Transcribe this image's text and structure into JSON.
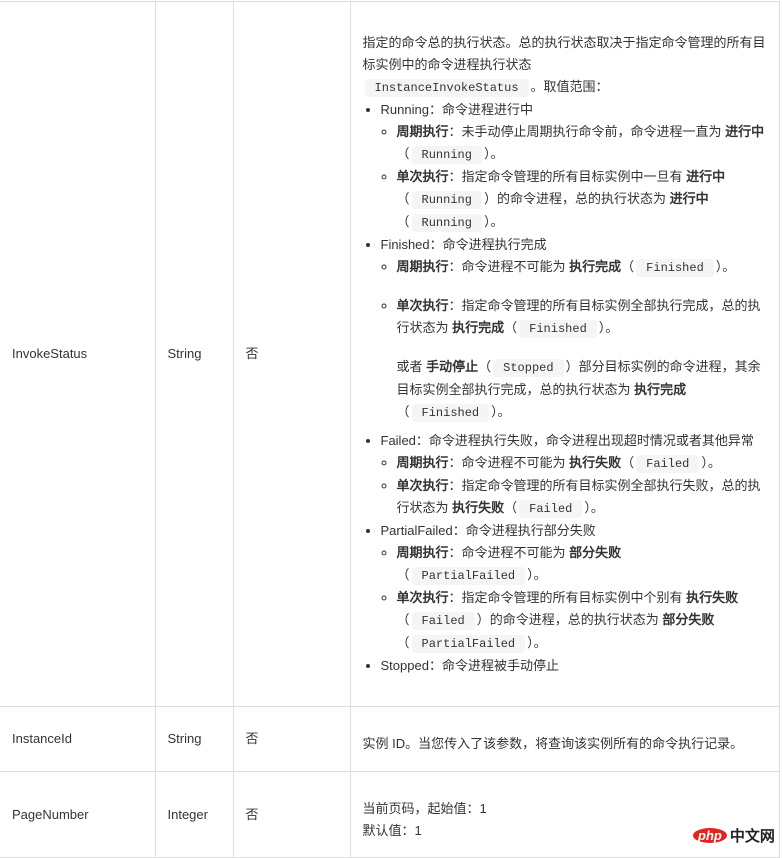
{
  "rows": [
    {
      "name": "InvokeStatus",
      "type": "String",
      "required": "否",
      "desc": {
        "intro_1": "指定的命令总的执行状态。总的执行状态取决于指定命令管理的所有目标实例中的命令进程执行状态",
        "intro_code": "InstanceInvokeStatus",
        "intro_2": "。取值范围：",
        "items": [
          {
            "value": "Running",
            "text": "：命令进程进行中",
            "subitems": [
              {
                "label": "周期执行",
                "t1": "：未手动停止周期执行命令前，命令进程一直为 ",
                "b1": "进行中",
                "t2": "（",
                "code1": "Running",
                "t3": "）。"
              },
              {
                "label": "单次执行",
                "t1": "：指定命令管理的所有目标实例中一旦有 ",
                "b1": "进行中",
                "t2": "（",
                "code1": "Running",
                "t3": "）的命令进程，总的执行状态为 ",
                "b2": "进行中",
                "t4": "（",
                "code2": "Running",
                "t5": "）。"
              }
            ]
          },
          {
            "value": "Finished",
            "text": "：命令进程执行完成",
            "subitems": [
              {
                "label": "周期执行",
                "t1": "：命令进程不可能为 ",
                "b1": "执行完成",
                "t2": "（",
                "code1": "Finished",
                "t3": "）。"
              },
              {
                "label": "单次执行",
                "t1": "：指定命令管理的所有目标实例全部执行完成，总的执行状态为 ",
                "b1": "执行完成",
                "t2": "（",
                "code1": "Finished",
                "t3": "）。",
                "extra_1": "或者 ",
                "extra_b1": "手动停止",
                "extra_2": "（",
                "extra_code1": "Stopped",
                "extra_3": "）部分目标实例的命令进程，其余目标实例全部执行完成，总的执行状态为 ",
                "extra_b2": "执行完成",
                "extra_4": "（",
                "extra_code2": "Finished",
                "extra_5": "）。"
              }
            ]
          },
          {
            "value": "Failed",
            "text": "：命令进程执行失败，命令进程出现超时情况或者其他异常",
            "subitems": [
              {
                "label": "周期执行",
                "t1": "：命令进程不可能为 ",
                "b1": "执行失败",
                "t2": "（",
                "code1": "Failed",
                "t3": "）。"
              },
              {
                "label": "单次执行",
                "t1": "：指定命令管理的所有目标实例全部执行失败，总的执行状态为 ",
                "b1": "执行失败",
                "t2": "（",
                "code1": "Failed",
                "t3": "）。"
              }
            ]
          },
          {
            "value": "PartialFailed",
            "text": "：命令进程执行部分失败",
            "subitems": [
              {
                "label": "周期执行",
                "t1": "：命令进程不可能为 ",
                "b1": "部分失败",
                "t2": "（",
                "code1": "PartialFailed",
                "t3": "）。"
              },
              {
                "label": "单次执行",
                "t1": "：指定命令管理的所有目标实例中个别有 ",
                "b1": "执行失败",
                "t2": "（",
                "code1": "Failed",
                "t3": "）的命令进程，总的执行状态为 ",
                "b2": "部分失败",
                "t4": "（",
                "code2": "PartialFailed",
                "t5": "）。"
              }
            ]
          },
          {
            "value": "Stopped",
            "text": "：命令进程被手动停止"
          }
        ]
      }
    },
    {
      "name": "InstanceId",
      "type": "String",
      "required": "否",
      "desc": {
        "text": "实例 ID。当您传入了该参数，将查询该实例所有的命令执行记录。"
      }
    },
    {
      "name": "PageNumber",
      "type": "Integer",
      "required": "否",
      "desc": {
        "text": "当前页码，起始值：1",
        "default": "默认值：1"
      }
    }
  ],
  "watermark": {
    "logo": "php",
    "text": "中文网",
    "brand_color": "#e4231f"
  }
}
